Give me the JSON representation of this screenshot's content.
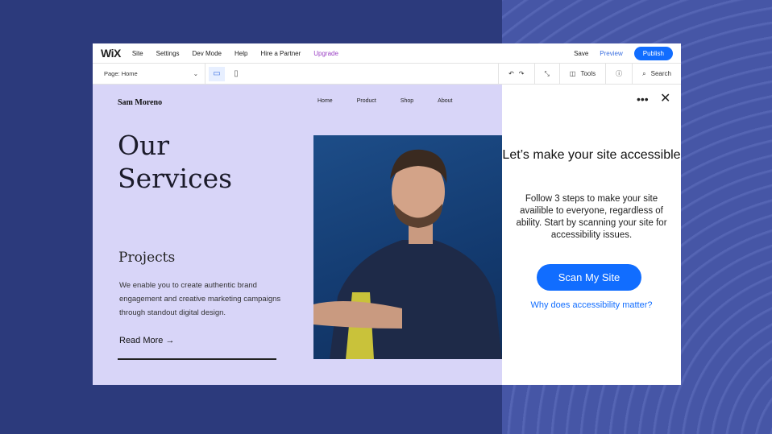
{
  "topbar": {
    "logo": "WiX",
    "menu": [
      "Site",
      "Settings",
      "Dev Mode",
      "Help",
      "Hire a Partner",
      "Upgrade"
    ],
    "save": "Save",
    "preview": "Preview",
    "publish": "Publish"
  },
  "toolbar": {
    "page_label": "Page:",
    "page_value": "Home",
    "tools": "Tools",
    "search": "Search"
  },
  "site": {
    "brand": "Sam Moreno",
    "nav": [
      "Home",
      "Product",
      "Shop",
      "About"
    ],
    "heading_1": "Our",
    "heading_2": "Services",
    "subheading": "Projects",
    "body": "We enable you to create authentic brand engagement and creative marketing campaigns through standout digital design.",
    "read_more": "Read More →"
  },
  "panel": {
    "title": "Let’s make your site accessible",
    "description": "Follow 3 steps to make your site availible to everyone, regardless of ability. Start by scanning your site for accessibility issues.",
    "scan_button": "Scan My Site",
    "link": "Why does accessibility matter?"
  },
  "colors": {
    "accent": "#116dff",
    "canvas": "#d8d5f8",
    "background": "#2c3a7c"
  }
}
